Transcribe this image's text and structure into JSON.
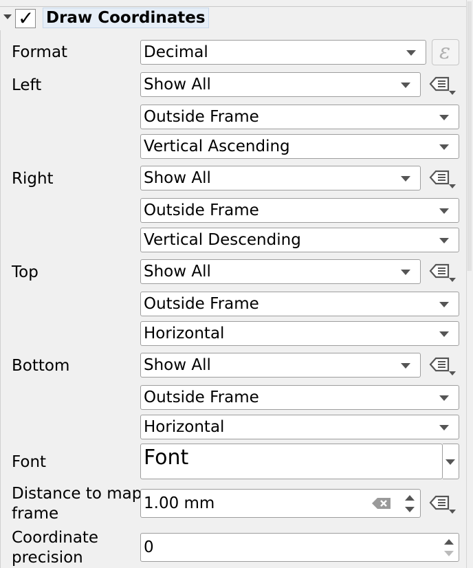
{
  "group": {
    "title": "Draw Coordinates",
    "checked": true
  },
  "labels": {
    "format": "Format",
    "left": "Left",
    "right": "Right",
    "top": "Top",
    "bottom": "Bottom",
    "font": "Font",
    "distance_line1": "Distance to map",
    "distance_line2": "frame",
    "precision_line1": "Coordinate",
    "precision_line2": "precision"
  },
  "format": {
    "value": "Decimal"
  },
  "left": {
    "display": "Show All",
    "position": "Outside Frame",
    "direction": "Vertical Ascending"
  },
  "right": {
    "display": "Show All",
    "position": "Outside Frame",
    "direction": "Vertical Descending"
  },
  "top": {
    "display": "Show All",
    "position": "Outside Frame",
    "direction": "Horizontal"
  },
  "bottom": {
    "display": "Show All",
    "position": "Outside Frame",
    "direction": "Horizontal"
  },
  "font": {
    "button_label": "Font"
  },
  "distance": {
    "value": "1.00 mm"
  },
  "precision": {
    "value": "0"
  },
  "icons": {
    "collapse": "chevron-down-icon",
    "check": "checkmark-icon",
    "expression": "epsilon-icon",
    "data_defined": "data-defined-override-icon",
    "clear": "clear-icon"
  }
}
